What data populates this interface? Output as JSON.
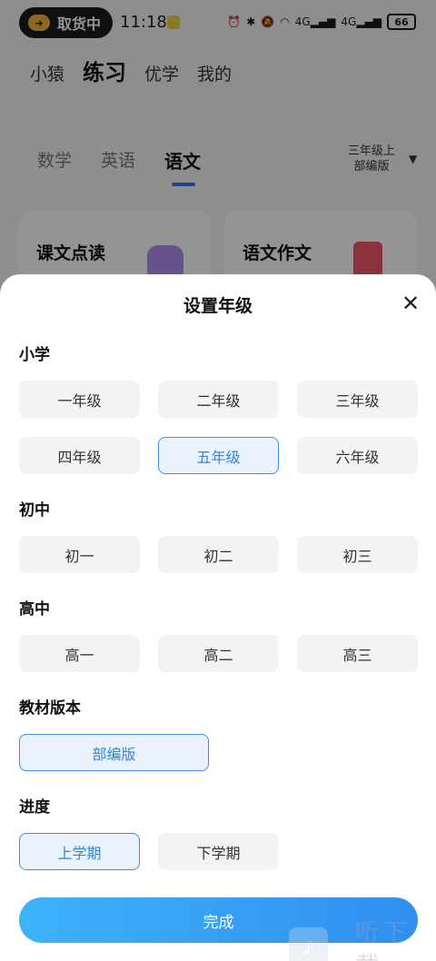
{
  "status_bar": {
    "pickup_label": "取货中",
    "time": "11:18",
    "network_1": "4G",
    "network_2": "4G",
    "battery": "66"
  },
  "top_nav": {
    "items": [
      "小猿",
      "练习",
      "优学",
      "我的"
    ],
    "active": "练习"
  },
  "subject_tabs": {
    "items": [
      "数学",
      "英语",
      "语文"
    ],
    "active": "语文"
  },
  "grade_selector": {
    "line1": "三年级上",
    "line2": "部编版"
  },
  "cards": [
    {
      "title": "课文点读"
    },
    {
      "title": "语文作文"
    }
  ],
  "sheet": {
    "title": "设置年级",
    "sections": {
      "primary": {
        "label": "小学",
        "options": [
          "一年级",
          "二年级",
          "三年级",
          "四年级",
          "五年级",
          "六年级"
        ],
        "selected": "五年级"
      },
      "junior": {
        "label": "初中",
        "options": [
          "初一",
          "初二",
          "初三"
        ]
      },
      "senior": {
        "label": "高中",
        "options": [
          "高一",
          "高二",
          "高三"
        ]
      },
      "textbook": {
        "label": "教材版本",
        "options": [
          "部编版"
        ],
        "selected": "部编版"
      },
      "progress": {
        "label": "进度",
        "options": [
          "上学期",
          "下学期"
        ],
        "selected": "上学期"
      }
    },
    "done_label": "完成"
  },
  "watermark": {
    "text": "听下载"
  },
  "colors": {
    "accent": "#2f86d8",
    "done_start": "#3fb2fb",
    "done_end": "#2f8ff0"
  }
}
